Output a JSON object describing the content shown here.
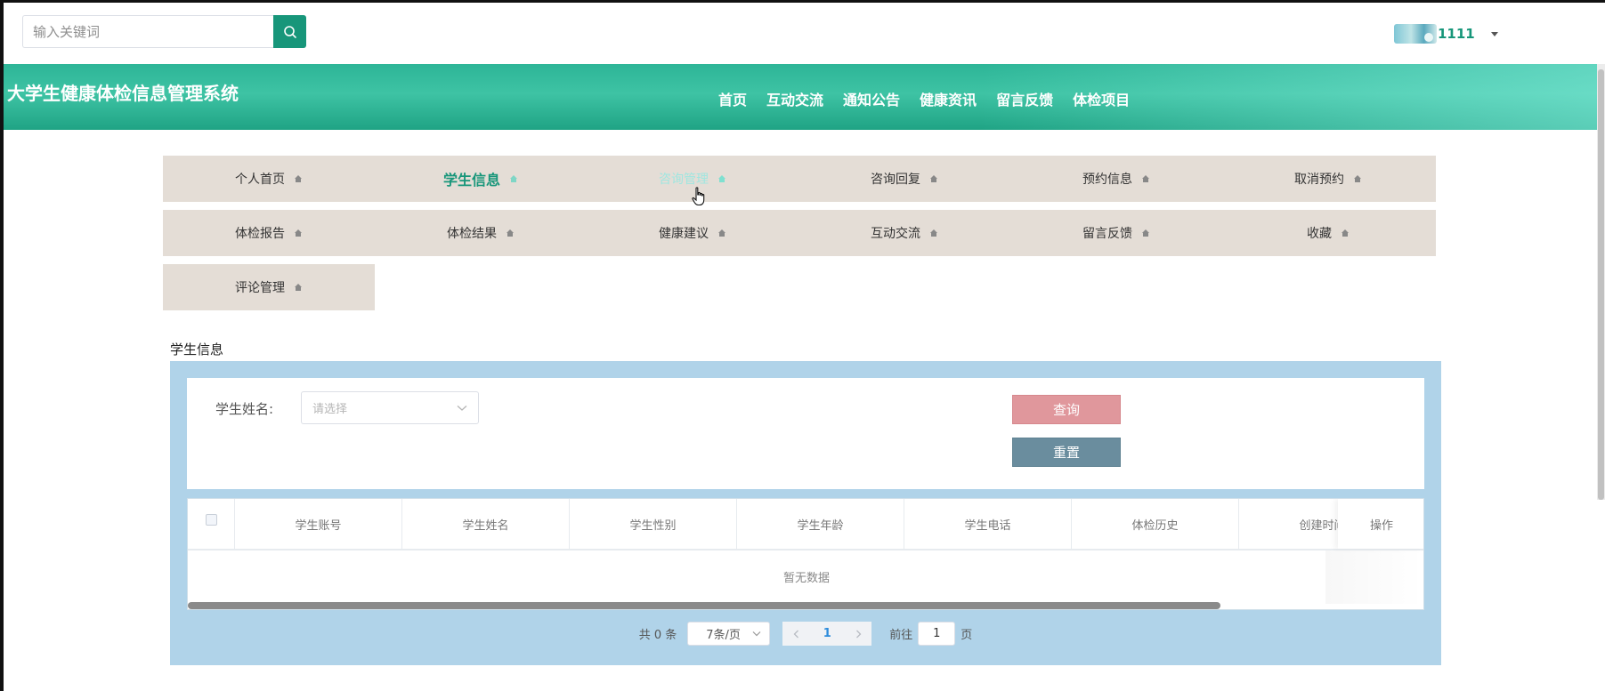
{
  "search": {
    "placeholder": "输入关键词"
  },
  "user": {
    "name": "1111"
  },
  "header": {
    "title": "大学生健康体检信息管理系统",
    "nav": [
      "首页",
      "互动交流",
      "通知公告",
      "健康资讯",
      "留言反馈",
      "体检项目"
    ]
  },
  "menu": {
    "row1": [
      "个人首页",
      "学生信息",
      "咨询管理",
      "咨询回复",
      "预约信息",
      "取消预约"
    ],
    "row2": [
      "体检报告",
      "体检结果",
      "健康建议",
      "互动交流",
      "留言反馈",
      "收藏"
    ],
    "row3": [
      "评论管理"
    ],
    "active": "学生信息",
    "hovered": "咨询管理"
  },
  "section": {
    "title": "学生信息"
  },
  "filter": {
    "label": "学生姓名:",
    "select_placeholder": "请选择",
    "query_button": "查询",
    "reset_button": "重置"
  },
  "table": {
    "columns": [
      "学生账号",
      "学生姓名",
      "学生性别",
      "学生年龄",
      "学生电话",
      "体检历史",
      "创建时间"
    ],
    "action_column": "操作",
    "empty_text": "暂无数据"
  },
  "pagination": {
    "total": "共 0 条",
    "page_size": "7条/页",
    "current_page": "1",
    "goto_label": "前往",
    "goto_value": "1",
    "page_suffix": "页"
  },
  "colors": {
    "brand": "#17967a",
    "header_gradient_start": "#2db597",
    "menu_bg": "#e4ddd6",
    "panel_bg": "#b0d3e9",
    "query_button": "#e0979c",
    "reset_button": "#6a8d9e"
  }
}
